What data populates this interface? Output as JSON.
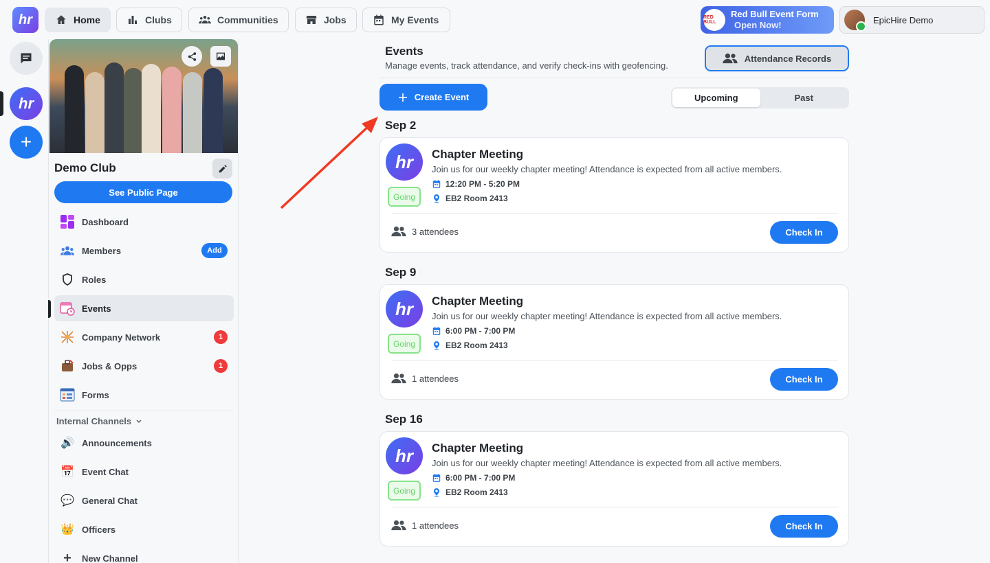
{
  "nav": {
    "logo": "hr",
    "items": [
      {
        "label": "Home"
      },
      {
        "label": "Clubs"
      },
      {
        "label": "Communities"
      },
      {
        "label": "Jobs"
      },
      {
        "label": "My Events"
      }
    ],
    "promo": {
      "line1": "Red Bull Event Form",
      "line2": "Open Now!",
      "logo_text": "RED BULL"
    },
    "user": {
      "name": "EpicHire Demo"
    }
  },
  "rail": {
    "club_logo": "hr",
    "add": "+"
  },
  "sidebar": {
    "club_name": "Demo Club",
    "public_page": "See Public Page",
    "items": [
      {
        "label": "Dashboard",
        "icon": "dashboard-icon"
      },
      {
        "label": "Members",
        "icon": "members-icon",
        "badge": "Add"
      },
      {
        "label": "Roles",
        "icon": "shield-icon"
      },
      {
        "label": "Events",
        "icon": "calendar-clock-icon"
      },
      {
        "label": "Company Network",
        "icon": "network-icon",
        "badge": "1"
      },
      {
        "label": "Jobs & Opps",
        "icon": "jobs-icon",
        "badge": "1"
      },
      {
        "label": "Forms",
        "icon": "forms-icon"
      }
    ],
    "section": "Internal Channels",
    "channels": [
      {
        "label": "Announcements",
        "icon": "speaker-icon"
      },
      {
        "label": "Event Chat",
        "icon": "calendar-icon"
      },
      {
        "label": "General Chat",
        "icon": "speech-bubble-icon"
      },
      {
        "label": "Officers",
        "icon": "crown-icon"
      },
      {
        "label": "New Channel",
        "icon": "plus-icon"
      }
    ]
  },
  "main": {
    "title": "Events",
    "subtitle": "Manage events, track attendance, and verify check-ins with geofencing.",
    "attendance_records": "Attendance Records",
    "create_event": "Create Event",
    "tabs": [
      "Upcoming",
      "Past"
    ],
    "events": [
      {
        "date": "Sep 2",
        "title": "Chapter Meeting",
        "desc": "Join us for our weekly chapter meeting! Attendance is expected from all active members.",
        "time": "12:20 PM - 5:20 PM",
        "location": "EB2 Room 2413",
        "status": "Going",
        "attendees": "3 attendees",
        "action": "Check In"
      },
      {
        "date": "Sep 9",
        "title": "Chapter Meeting",
        "desc": "Join us for our weekly chapter meeting! Attendance is expected from all active members.",
        "time": "6:00 PM - 7:00 PM",
        "location": "EB2 Room 2413",
        "status": "Going",
        "attendees": "1 attendees",
        "action": "Check In"
      },
      {
        "date": "Sep 16",
        "title": "Chapter Meeting",
        "desc": "Join us for our weekly chapter meeting! Attendance is expected from all active members.",
        "time": "6:00 PM - 7:00 PM",
        "location": "EB2 Room 2413",
        "status": "Going",
        "attendees": "1 attendees",
        "action": "Check In"
      }
    ]
  },
  "colors": {
    "accent": "#1f7af2",
    "badge": "#ef3b3b",
    "going": "#67d36e",
    "annotation": "#f03a24"
  }
}
